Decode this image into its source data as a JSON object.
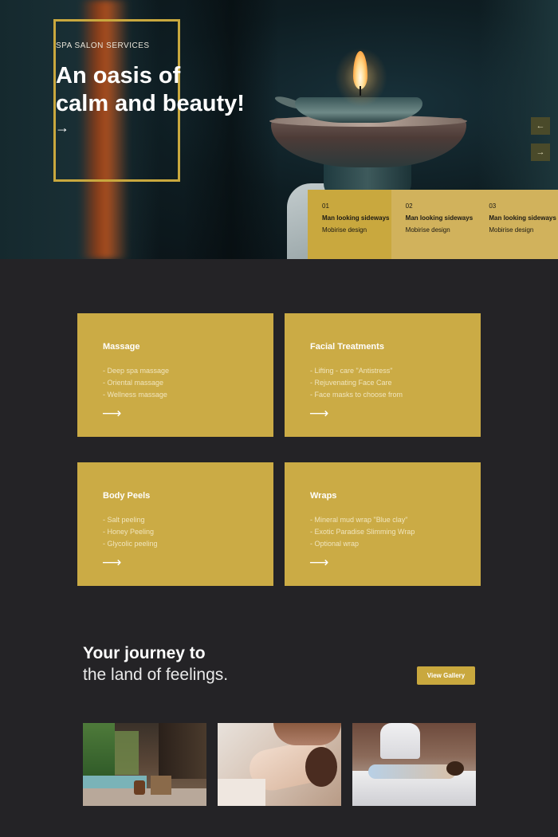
{
  "hero": {
    "eyebrow": "SPA SALON SERVICES",
    "title_line1": "An oasis of",
    "title_line2": "calm and beauty!",
    "arrow_icon": "→",
    "prev_icon": "←",
    "next_icon": "→",
    "slides": [
      {
        "num": "01",
        "title": "Man looking sideways",
        "subtitle": "Mobirise design"
      },
      {
        "num": "02",
        "title": "Man looking sideways",
        "subtitle": "Mobirise design"
      },
      {
        "num": "03",
        "title": "Man looking sideways",
        "subtitle": "Mobirise design"
      }
    ]
  },
  "services": [
    {
      "title": "Massage",
      "items": [
        "- Deep spa massage",
        "- Oriental massage",
        "- Wellness massage"
      ],
      "arrow": "⟶"
    },
    {
      "title": "Facial Treatments",
      "items": [
        "- Lifting - care \"Antistress\"",
        "- Rejuvenating Face Care",
        "- Face masks to choose from"
      ],
      "arrow": "⟶"
    },
    {
      "title": "Body Peels",
      "items": [
        "- Salt peeling",
        "- Honey Peeling",
        "- Glycolic peeling"
      ],
      "arrow": "⟶"
    },
    {
      "title": "Wraps",
      "items": [
        "- Mineral mud wrap \"Blue clay\"",
        "- Exotic Paradise Slimming Wrap",
        "- Optional wrap"
      ],
      "arrow": "⟶"
    }
  ],
  "journey": {
    "title_bold": "Your journey to",
    "title_light": "the land of feelings.",
    "button": "View Gallery"
  },
  "colors": {
    "accent": "#c9a83e",
    "card": "#cbab45",
    "background": "#242326"
  }
}
